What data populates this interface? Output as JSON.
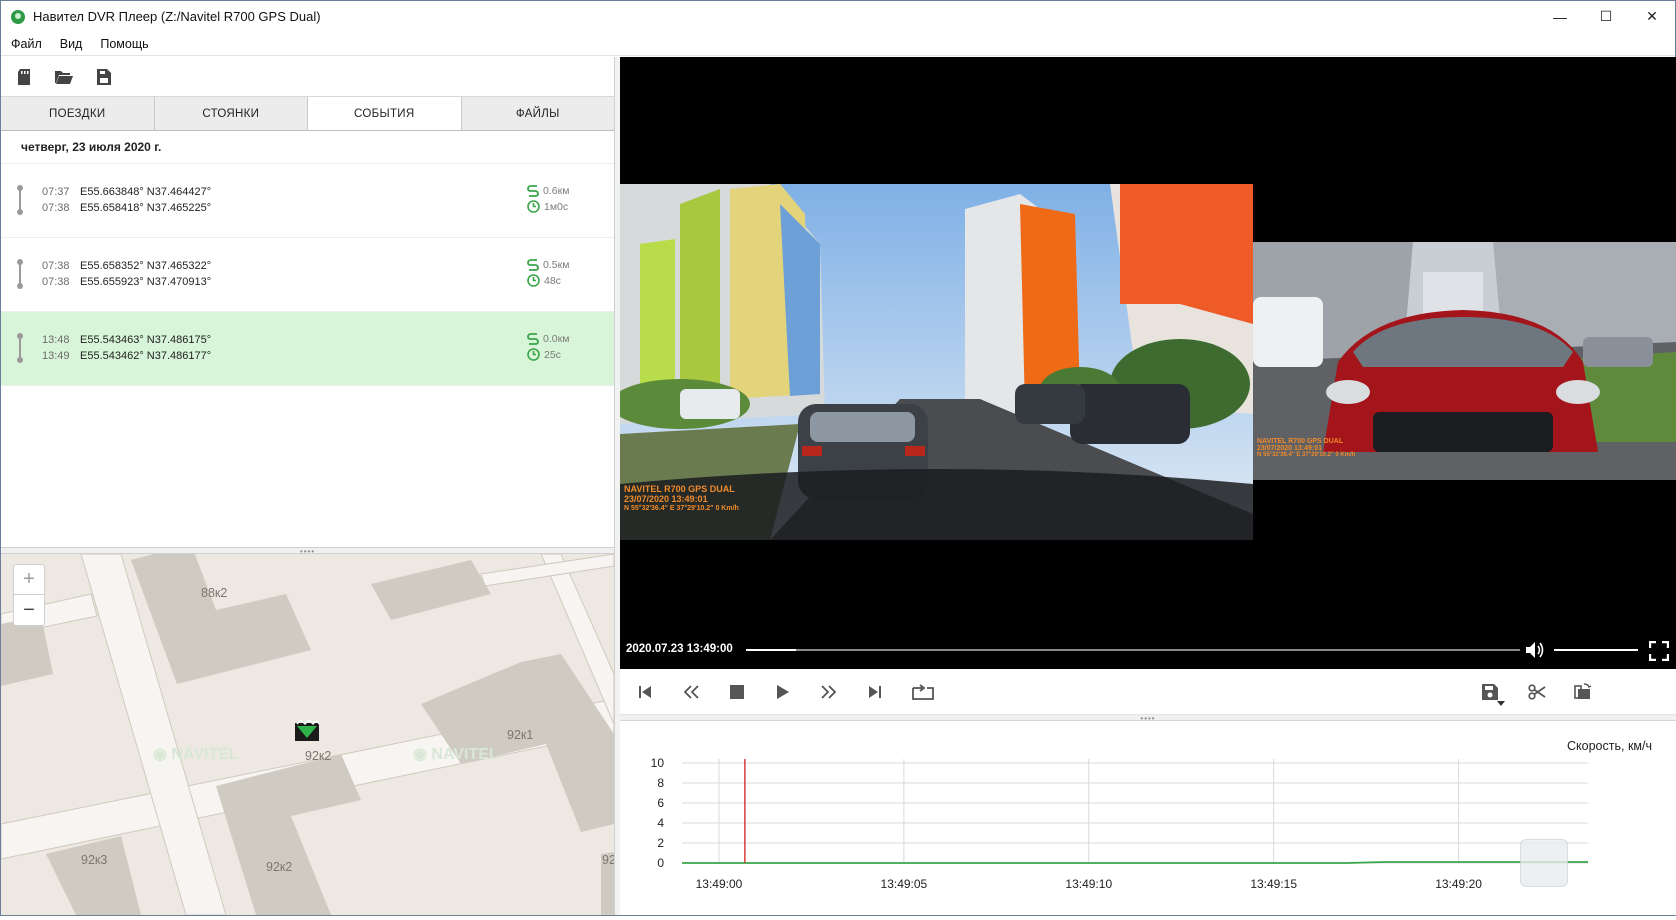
{
  "window": {
    "title": "Навител DVR Плеер (Z:/Navitel R700 GPS Dual)",
    "minimize": "—",
    "maximize": "☐",
    "close": "✕"
  },
  "menu": [
    "Файл",
    "Вид",
    "Помощь"
  ],
  "toolbar": {
    "icons": [
      "sd-card-icon",
      "open-folder-icon",
      "save-file-icon"
    ]
  },
  "tabs": [
    {
      "label": "ПОЕЗДКИ",
      "active": false
    },
    {
      "label": "СТОЯНКИ",
      "active": false
    },
    {
      "label": "СОБЫТИЯ",
      "active": true
    },
    {
      "label": "ФАЙЛЫ",
      "active": false
    }
  ],
  "day_header": "четверг, 23 июля 2020 г.",
  "trips": [
    {
      "start_time": "07:37",
      "start_coord": "E55.663848° N37.464427°",
      "end_time": "07:38",
      "end_coord": "E55.658418° N37.465225°",
      "distance": "0.6км",
      "duration": "1м0с",
      "selected": false
    },
    {
      "start_time": "07:38",
      "start_coord": "E55.658352° N37.465322°",
      "end_time": "07:38",
      "end_coord": "E55.655923° N37.470913°",
      "distance": "0.5км",
      "duration": "48с",
      "selected": false
    },
    {
      "start_time": "13:48",
      "start_coord": "E55.543463° N37.486175°",
      "end_time": "13:49",
      "end_coord": "E55.543462° N37.486177°",
      "distance": "0.0км",
      "duration": "25с",
      "selected": true
    }
  ],
  "map": {
    "zoom_in": "+",
    "zoom_out": "−",
    "labels": [
      "88к2",
      "92к2",
      "92к1",
      "92к3",
      "92к2",
      "92"
    ],
    "watermark": "NAVITEL"
  },
  "video": {
    "timestamp": "2020.07.23 13:49:00",
    "progress": 0.065,
    "volume": 1.0,
    "front_overlay": [
      "NAVITEL R700 GPS DUAL",
      "23/07/2020 13:49:01",
      "N 55°32'36.4\" E 37°29'10.2\"   0 Km/h"
    ],
    "rear_overlay": [
      "NAVITEL R700 GPS DUAL",
      "23/07/2020 13:49:01",
      "N 55°32'36.4\" E 37°29'10.2\"   0 Km/h"
    ]
  },
  "chart_data": {
    "type": "line",
    "title": "Скорость, км/ч",
    "y_ticks": [
      10,
      8,
      6,
      4,
      2,
      0
    ],
    "ylim": [
      0,
      10
    ],
    "x_ticks": [
      "13:49:00",
      "13:49:05",
      "13:49:10",
      "13:49:15",
      "13:49:20"
    ],
    "x_seconds": [
      0,
      5,
      10,
      15,
      20
    ],
    "xlim": [
      -1,
      23.5
    ],
    "series": [
      {
        "values": [
          0,
          0,
          0,
          0,
          0,
          0,
          0,
          0,
          0,
          0,
          0,
          0,
          0,
          0,
          0,
          0,
          0,
          0,
          0,
          0.1,
          0.1,
          0.1,
          0.1,
          0.1,
          0.1
        ],
        "x": [
          -1,
          0,
          1,
          2,
          3,
          4,
          5,
          6,
          7,
          8,
          9,
          10,
          11,
          12,
          13,
          14,
          15,
          16,
          17,
          18,
          19,
          20,
          21,
          22,
          23.5
        ],
        "color": "#3aa64a"
      }
    ],
    "cursor_x": 0.7,
    "cursor_color": "#d83030",
    "grid": true
  }
}
